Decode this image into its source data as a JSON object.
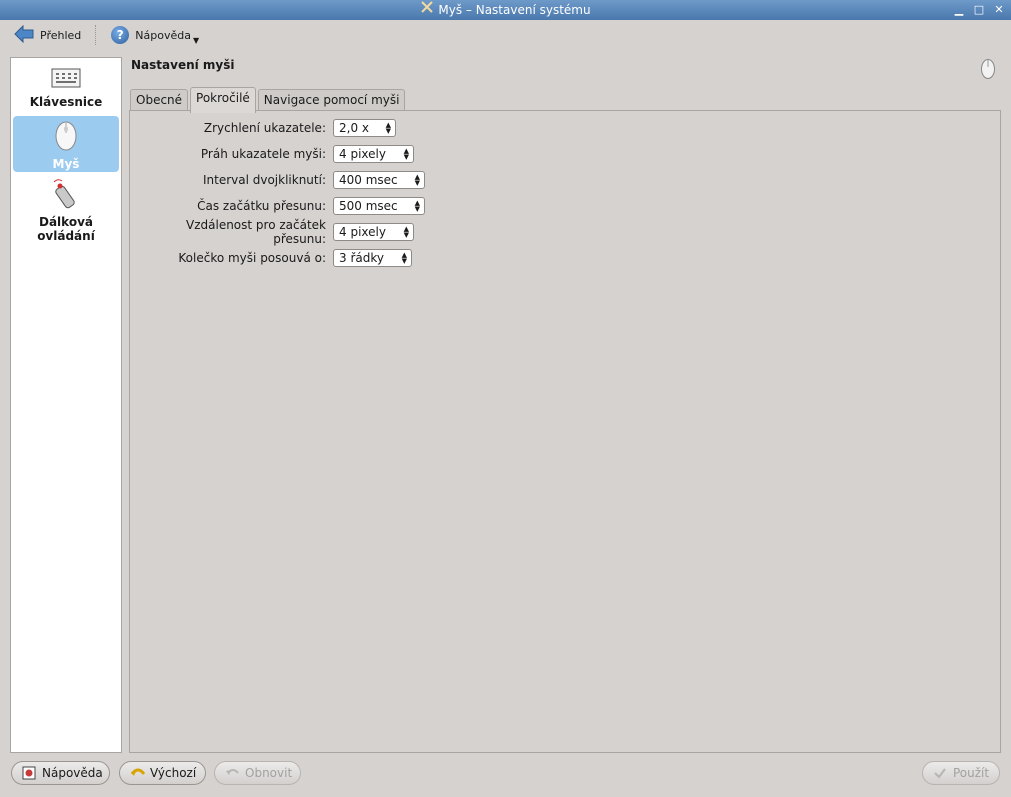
{
  "window": {
    "title": "Myš – Nastavení systému"
  },
  "toolbar": {
    "overview_label": "Přehled",
    "help_label": "Nápověda"
  },
  "sidebar": {
    "items": [
      {
        "label": "Klávesnice",
        "icon": "keyboard-icon",
        "active": false
      },
      {
        "label": "Myš",
        "icon": "mouse-icon",
        "active": true
      },
      {
        "label_line1": "Dálková",
        "label_line2": "ovládání",
        "icon": "remote-control-icon",
        "active": false
      }
    ]
  },
  "page": {
    "title": "Nastavení myši"
  },
  "tabs": [
    {
      "label": "Obecné",
      "active": false
    },
    {
      "label": "Pokročilé",
      "active": true
    },
    {
      "label": "Navigace pomocí myši",
      "active": false
    }
  ],
  "settings": [
    {
      "label": "Zrychlení ukazatele:",
      "value": "2,0 x"
    },
    {
      "label": "Práh ukazatele myši:",
      "value": "4 pixely"
    },
    {
      "label": "Interval dvojkliknutí:",
      "value": "400 msec"
    },
    {
      "label": "Čas začátku přesunu:",
      "value": "500 msec"
    },
    {
      "label": "Vzdálenost pro začátek přesunu:",
      "value": "4 pixely"
    },
    {
      "label": "Kolečko myši posouvá o:",
      "value": "3 řádky"
    }
  ],
  "buttons": {
    "help": "Nápověda",
    "defaults": "Výchozí",
    "reset": "Obnovit",
    "apply": "Použít"
  },
  "colors": {
    "accent": "#9ccbf0",
    "titlebar": "#4a78ad"
  }
}
